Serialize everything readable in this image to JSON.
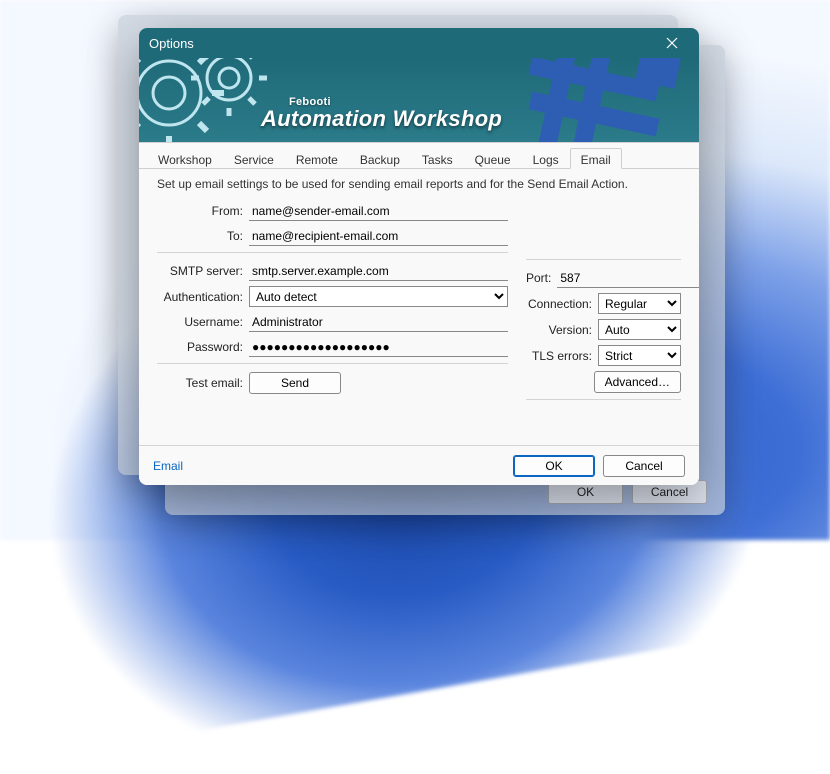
{
  "window": {
    "title": "Options"
  },
  "banner": {
    "brand_sup": "Febooti",
    "brand": "Automation Workshop"
  },
  "tabs": [
    "Workshop",
    "Service",
    "Remote",
    "Backup",
    "Tasks",
    "Queue",
    "Logs",
    "Email"
  ],
  "active_tab": "Email",
  "description": "Set up email settings to be used for sending email reports and for the Send Email Action.",
  "labels": {
    "from": "From:",
    "to": "To:",
    "smtp": "SMTP server:",
    "auth": "Authentication:",
    "user": "Username:",
    "pass": "Password:",
    "test": "Test email:",
    "port": "Port:",
    "conn": "Connection:",
    "ver": "Version:",
    "tls": "TLS errors:"
  },
  "values": {
    "from": "name@sender-email.com",
    "to": "name@recipient-email.com",
    "smtp": "smtp.server.example.com",
    "auth": "Auto detect",
    "user": "Administrator",
    "pass": "●●●●●●●●●●●●●●●●●●●",
    "port": "587",
    "conn": "Regular",
    "ver": "Auto",
    "tls": "Strict"
  },
  "buttons": {
    "advanced": "Advanced…",
    "send": "Send",
    "ok": "OK",
    "cancel": "Cancel"
  },
  "footer_link": "Email"
}
